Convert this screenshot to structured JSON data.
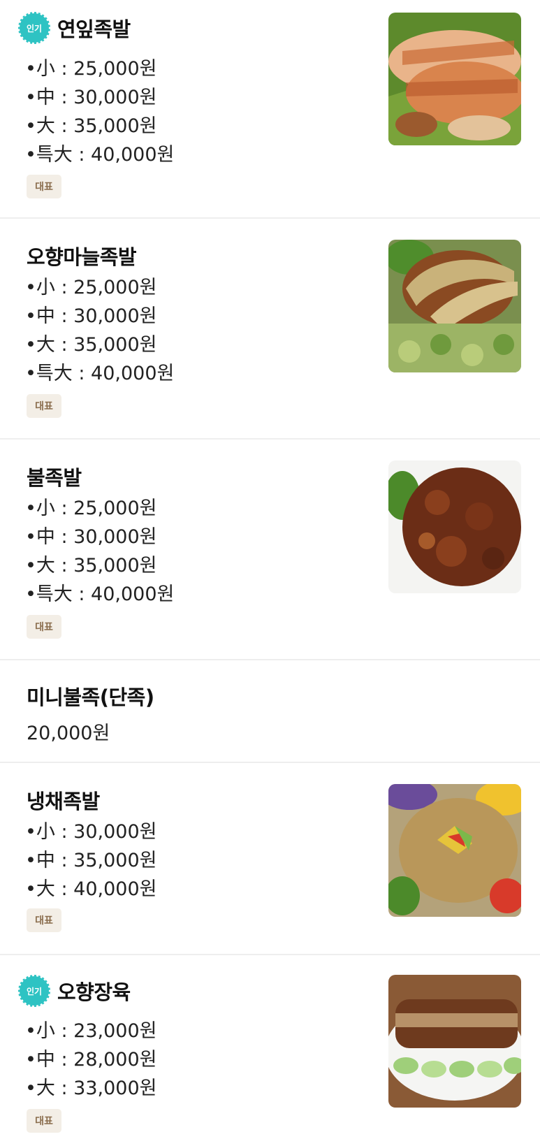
{
  "menu_items": [
    {
      "popular_badge": "인기",
      "name": "연잎족발",
      "options": [
        "•小 : 25,000원",
        "•中 : 30,000원",
        "•大 : 35,000원",
        "•특大 : 40,000원"
      ],
      "tag": "대표",
      "image": "pork-hock-lotus-leaf-photo"
    },
    {
      "name": "오향마늘족발",
      "options": [
        "•小 : 25,000원",
        "•中 : 30,000원",
        "•大 : 35,000원",
        "•특大 : 40,000원"
      ],
      "tag": "대표",
      "image": "garlic-pork-hock-photo"
    },
    {
      "name": "불족발",
      "options": [
        "•小 : 25,000원",
        "•中 : 30,000원",
        "•大 : 35,000원",
        "•특大 : 40,000원"
      ],
      "tag": "대표",
      "image": "spicy-pork-hock-photo"
    },
    {
      "name": "미니불족(단족)",
      "price": "20,000원"
    },
    {
      "name": "냉채족발",
      "options": [
        "•小 : 30,000원",
        "•中 : 35,000원",
        "•大 : 40,000원"
      ],
      "tag": "대표",
      "image": "cold-salad-pork-hock-photo"
    },
    {
      "popular_badge": "인기",
      "name": "오향장육",
      "options": [
        "•小 : 23,000원",
        "•中 : 28,000원",
        "•大 : 33,000원"
      ],
      "tag": "대표",
      "image": "five-spice-pork-photo"
    }
  ],
  "colors": {
    "popular_badge": "#2ec3c3",
    "tag_bg": "#f3eee6",
    "tag_text": "#8a6d4d",
    "divider": "#eeeeee"
  }
}
